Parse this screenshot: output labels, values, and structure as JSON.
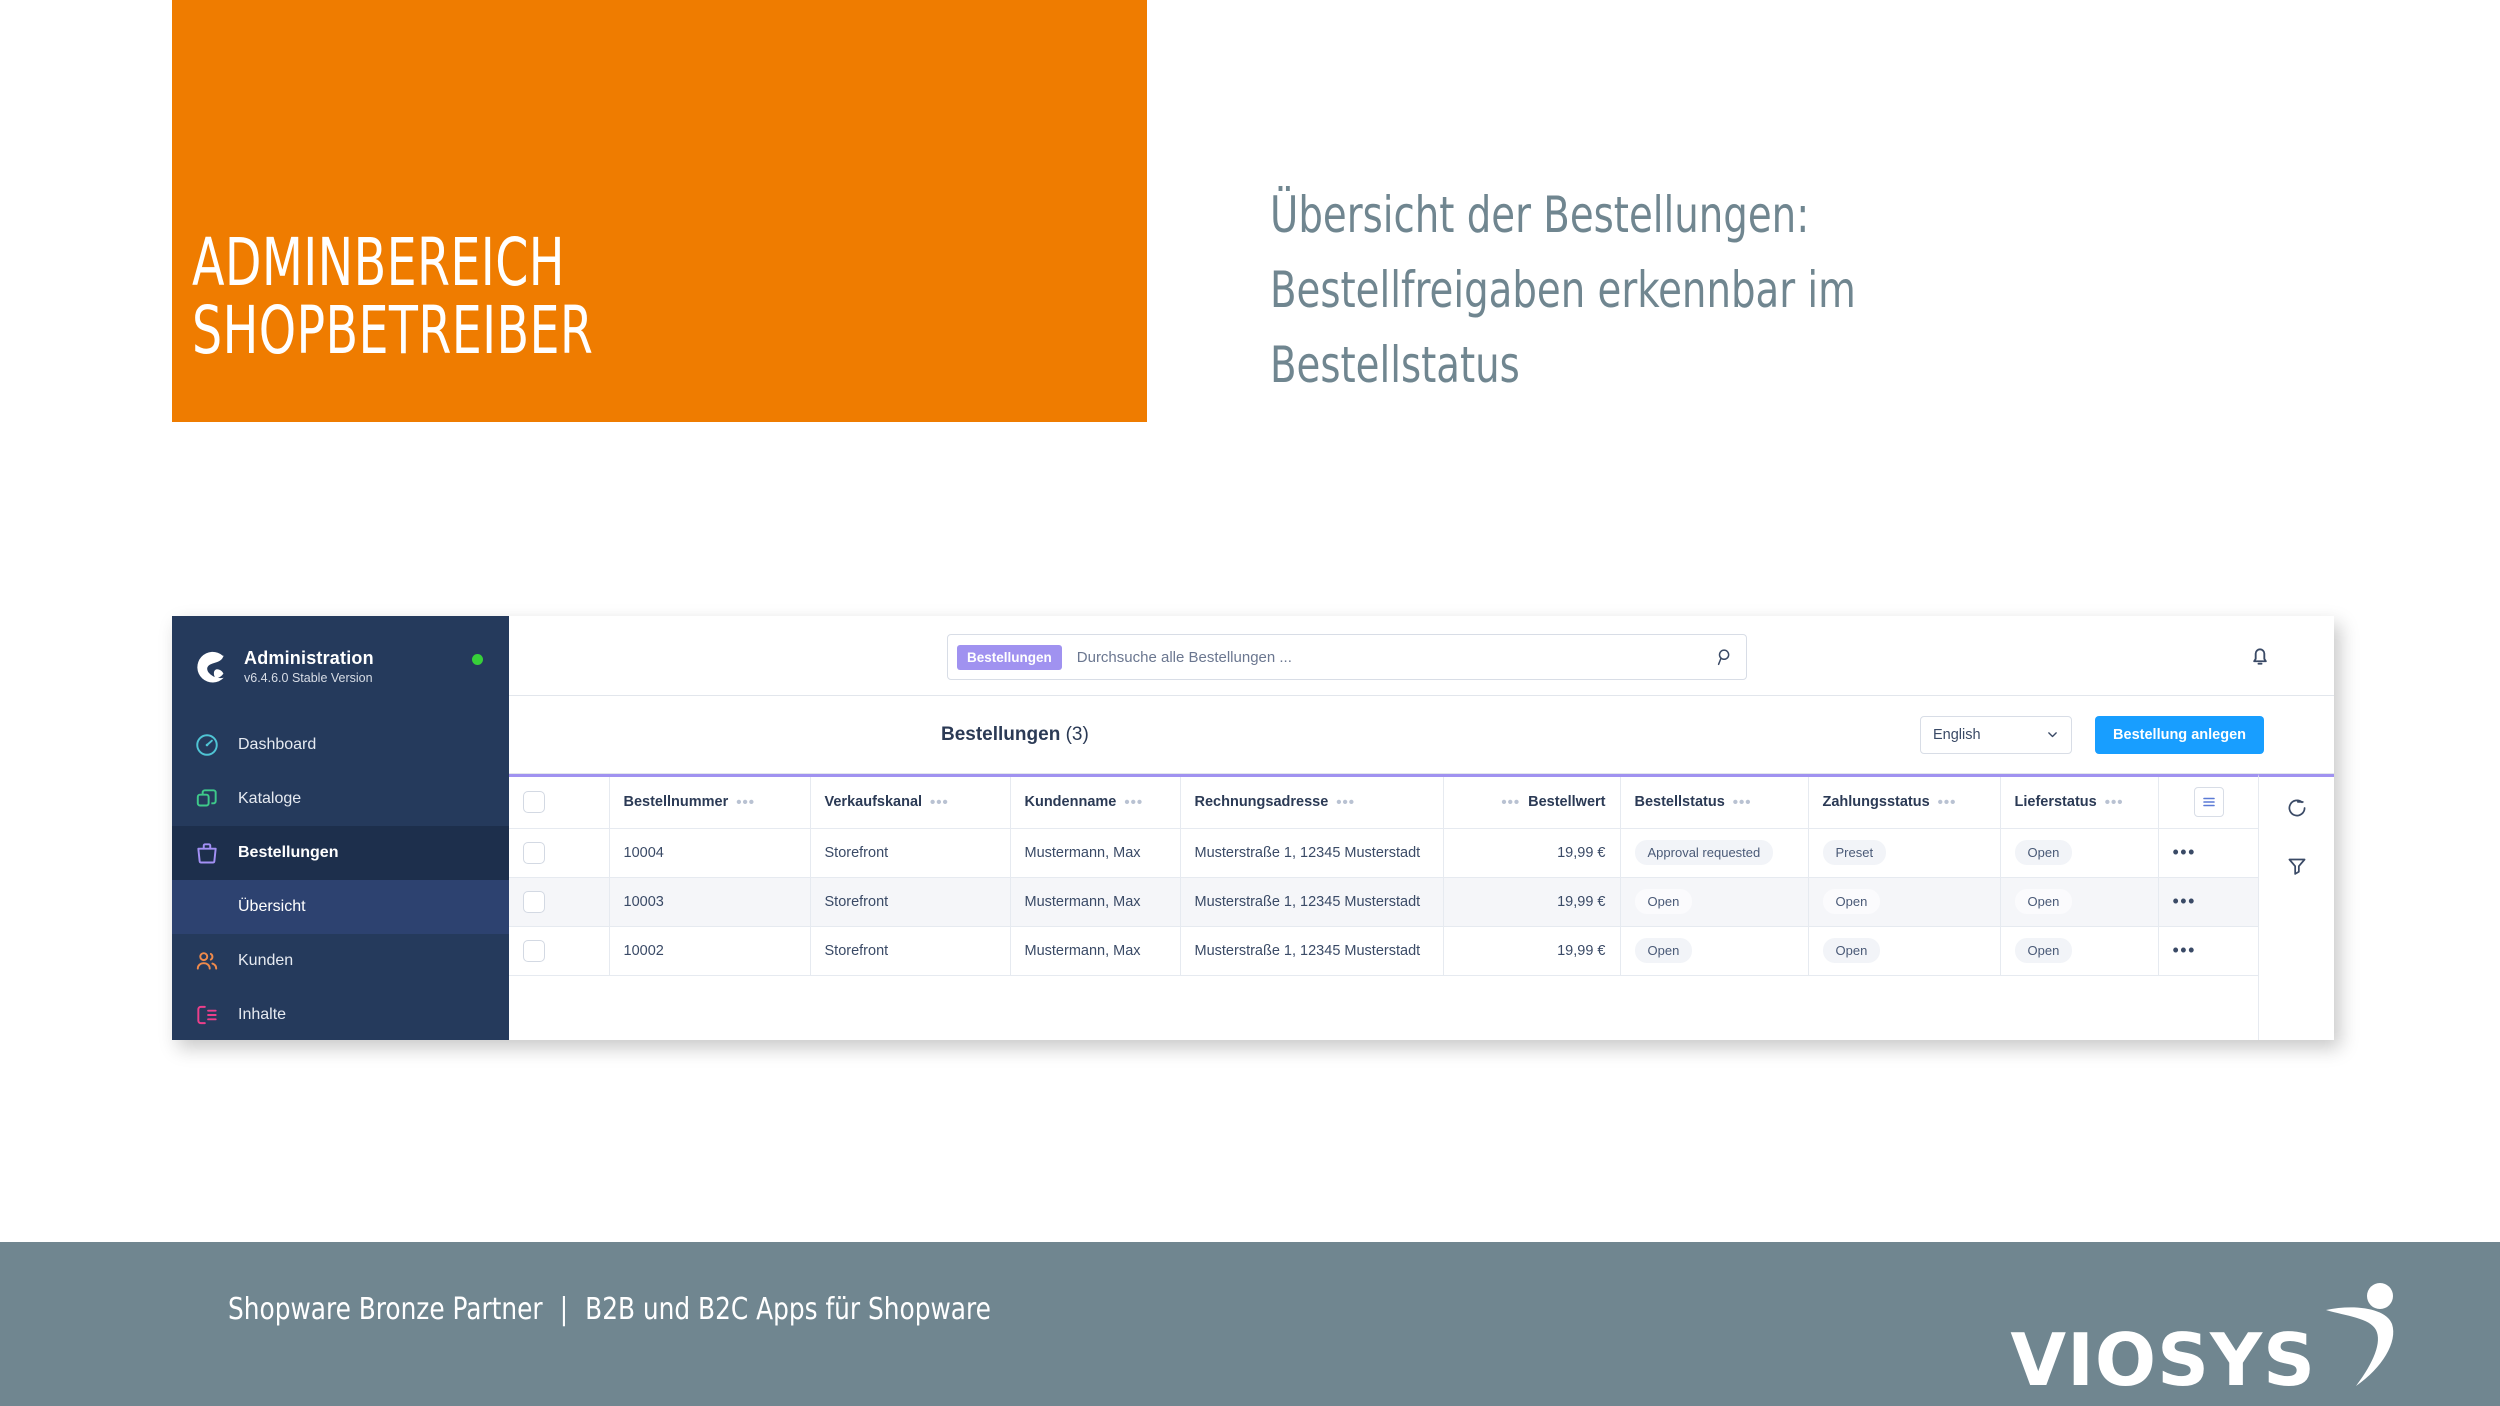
{
  "slide": {
    "title_lines": [
      "ADMINBEREICH",
      "SHOPBETREIBER"
    ],
    "heading_lines": [
      "Übersicht der Bestellungen:",
      "Bestellfreigaben erkennbar im",
      "Bestellstatus"
    ],
    "accent_orange": "#ef7c00",
    "heading_color": "#708690"
  },
  "admin": {
    "sidebar": {
      "app_title": "Administration",
      "version": "v6.4.6.0 Stable Version",
      "status_dot_color": "#37d039",
      "items": [
        {
          "label": "Dashboard",
          "icon": "dashboard-icon"
        },
        {
          "label": "Kataloge",
          "icon": "catalog-icon"
        },
        {
          "label": "Bestellungen",
          "icon": "orders-icon"
        },
        {
          "label": "Kunden",
          "icon": "customers-icon"
        },
        {
          "label": "Inhalte",
          "icon": "content-icon"
        }
      ],
      "sub_item": "Übersicht"
    },
    "topbar": {
      "search_chip": "Bestellungen",
      "search_placeholder": "Durchsuche alle Bestellungen ...",
      "search_value": "",
      "search_icon": "search-icon",
      "bell_icon": "bell-icon"
    },
    "toolbar": {
      "title": "Bestellungen",
      "count": "(3)",
      "language": "English",
      "create_button": "Bestellung anlegen",
      "accent_blue": "#189eff"
    },
    "table": {
      "columns": [
        "Bestellnummer",
        "Verkaufskanal",
        "Kundenname",
        "Rechnungsadresse",
        "Bestellwert",
        "Bestellstatus",
        "Zahlungsstatus",
        "Lieferstatus"
      ],
      "rows": [
        {
          "number": "10004",
          "channel": "Storefront",
          "customer": "Mustermann, Max",
          "address": "Musterstraße 1, 12345 Musterstadt",
          "value": "19,99 €",
          "order_status": "Approval requested",
          "payment_status": "Preset",
          "delivery_status": "Open",
          "actions": "•••"
        },
        {
          "number": "10003",
          "channel": "Storefront",
          "customer": "Mustermann, Max",
          "address": "Musterstraße 1, 12345 Musterstadt",
          "value": "19,99 €",
          "order_status": "Open",
          "payment_status": "Open",
          "delivery_status": "Open",
          "actions": "•••"
        },
        {
          "number": "10002",
          "channel": "Storefront",
          "customer": "Mustermann, Max",
          "address": "Musterstraße 1, 12345 Musterstadt",
          "value": "19,99 €",
          "order_status": "Open",
          "payment_status": "Open",
          "delivery_status": "Open",
          "actions": "•••"
        }
      ],
      "side_actions": [
        "refresh-icon",
        "filter-icon"
      ],
      "column_settings_icon": "list-settings-icon"
    }
  },
  "footer": {
    "text_left": "Shopware Bronze Partner",
    "separator": "|",
    "text_right": "B2B und B2C Apps  für Shopware",
    "logo_word": "VIOSYS",
    "background": "#708690"
  }
}
